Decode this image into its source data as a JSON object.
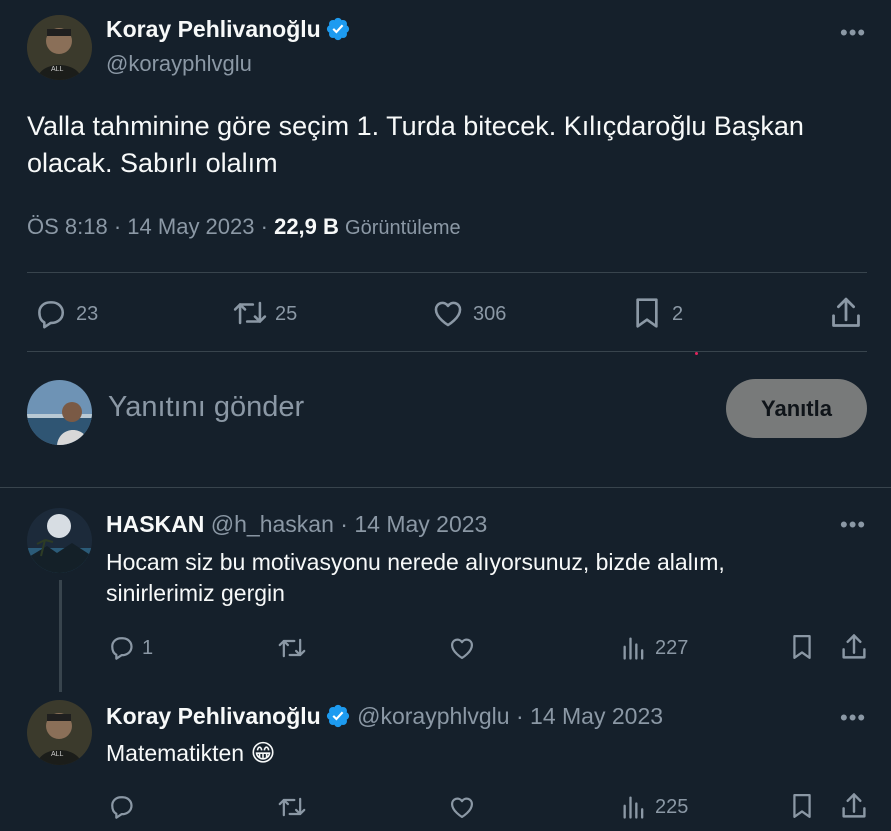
{
  "main_tweet": {
    "author_name": "Koray Pehlivanoğlu",
    "author_handle": "@korayphlvglu",
    "text_line1": "Valla tahminine göre seçim 1. Turda bitecek. Kılıçdaroğlu Başkan",
    "text_line2": "olacak. Sabırlı olalım",
    "time": "ÖS 8:18",
    "date": "14 May 2023",
    "views_count": "22,9 B",
    "views_label": "Görüntüleme",
    "stats": {
      "replies": "23",
      "retweets": "25",
      "likes": "306",
      "bookmarks": "2"
    }
  },
  "composer": {
    "placeholder": "Yanıtını gönder",
    "button_label": "Yanıtla"
  },
  "replies": [
    {
      "author_name": "HASKAN",
      "author_handle": "@h_haskan",
      "date": "14 May 2023",
      "text_line1": "Hocam siz bu motivasyonu nerede alıyorsunuz, bizde alalım,",
      "text_line2": "sinirlerimiz gergin",
      "reply_count": "1",
      "views": "227"
    },
    {
      "author_name": "Koray Pehlivanoğlu",
      "author_handle": "@korayphlvglu",
      "date": "14 May 2023",
      "text": "Matematikten",
      "emoji": "😁",
      "views": "225"
    }
  ],
  "separator": "·",
  "more_glyph": "•••",
  "colors": {
    "background": "#15202b",
    "verified": "#1d9bf0",
    "muted": "#8b98a5",
    "divider": "#38444d",
    "button": "#787a7a"
  },
  "icons": [
    "verified-badge-icon",
    "more-icon",
    "reply-icon",
    "retweet-icon",
    "like-icon",
    "bookmark-icon",
    "share-icon",
    "views-icon"
  ]
}
